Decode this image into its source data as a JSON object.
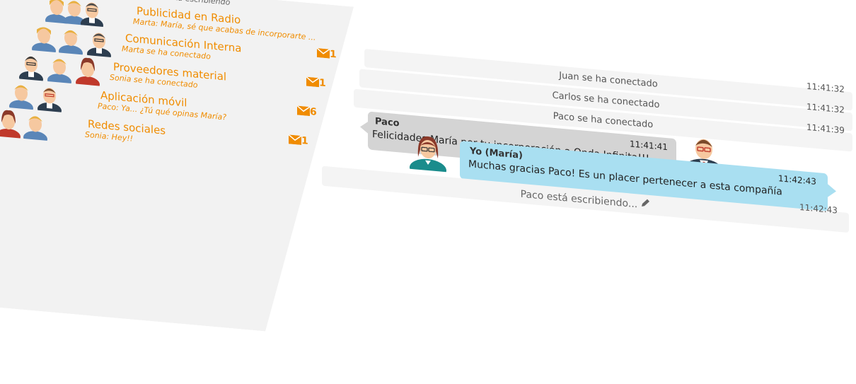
{
  "sidebar": {
    "top_status": "Paco está escribiendo",
    "conversations": [
      {
        "title": "Publicidad en Radio",
        "subtitle": "Marta: María, sé que acabas de incorporarte ...",
        "unread": ""
      },
      {
        "title": "Comunicación Interna",
        "subtitle": "Marta se ha conectado",
        "unread": "1"
      },
      {
        "title": "Proveedores material",
        "subtitle": "Sonia se ha conectado",
        "unread": "1"
      },
      {
        "title": "Aplicación móvil",
        "subtitle": "Paco: Ya... ¿Tú qué opinas María?",
        "unread": "6"
      },
      {
        "title": "Redes sociales",
        "subtitle": "Sonia: Hey!!",
        "unread": "1"
      }
    ]
  },
  "chat": {
    "system_messages": [
      {
        "text": "Juan se ha conectado",
        "time": "11:41:32"
      },
      {
        "text": "Carlos se ha conectado",
        "time": "11:41:32"
      },
      {
        "text": "Paco se ha conectado",
        "time": "11:41:39"
      }
    ],
    "messages": [
      {
        "sender": "Paco",
        "time": "11:41:41",
        "text": "Felicidades María por tu incorporación a Onda Infinita!!!"
      },
      {
        "sender": "Yo (María)",
        "time": "11:42:43",
        "text": "Muchas gracias Paco! Es un placer pertenecer a esta compañía"
      }
    ],
    "typing": {
      "text": "Paco está escribiendo...",
      "time": "11:42:43"
    }
  },
  "colors": {
    "accent": "#f08c00",
    "bubble_other": "#d4d4d4",
    "bubble_me": "#a9dff1"
  },
  "icons": {
    "unread": "envelope-icon",
    "typing": "pencil-icon"
  }
}
